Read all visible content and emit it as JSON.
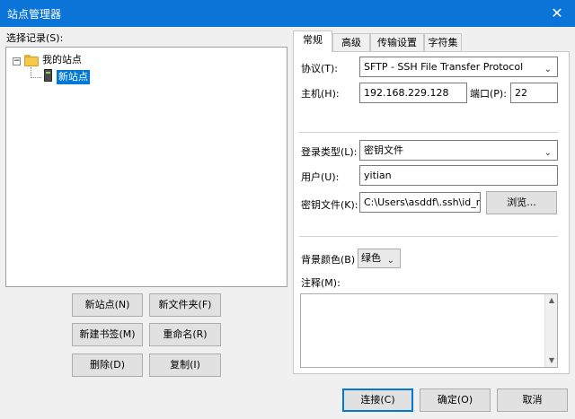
{
  "window": {
    "title": "站点管理器",
    "close_glyph": "✕"
  },
  "left": {
    "select_label": "选择记录(S):",
    "tree": {
      "root": "我的站点",
      "child": "新站点",
      "expander": "−"
    },
    "buttons": {
      "new_site": "新站点(N)",
      "new_folder": "新文件夹(F)",
      "new_bookmark": "新建书签(M)",
      "rename": "重命名(R)",
      "delete": "删除(D)",
      "copy": "复制(I)"
    }
  },
  "tabs": [
    "常规",
    "高级",
    "传输设置",
    "字符集"
  ],
  "general": {
    "protocol_label": "协议(T):",
    "protocol_value": "SFTP - SSH File Transfer Protocol",
    "host_label": "主机(H):",
    "host_value": "192.168.229.128",
    "port_label": "端口(P):",
    "port_value": "22",
    "logon_type_label": "登录类型(L):",
    "logon_type_value": "密钥文件",
    "user_label": "用户(U):",
    "user_value": "yitian",
    "keyfile_label": "密钥文件(K):",
    "keyfile_value": "C:\\Users\\asddf\\.ssh\\id_r",
    "browse_label": "浏览...",
    "bgcolor_label": "背景颜色(B)",
    "bgcolor_value": "绿色",
    "comments_label": "注释(M):"
  },
  "footer": {
    "connect": "连接(C)",
    "ok": "确定(O)",
    "cancel": "取消"
  },
  "icons": {
    "chevron_down": "⌄",
    "scroll_up": "▲",
    "scroll_down": "▼"
  },
  "colors": {
    "titlebar": "#0a74d9",
    "selection": "#0078d7"
  }
}
